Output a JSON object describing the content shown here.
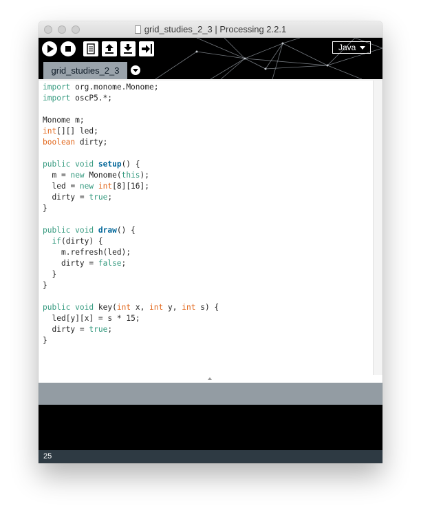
{
  "window": {
    "title": "grid_studies_2_3 | Processing 2.2.1",
    "traffic_lights": [
      "close-button",
      "minimize-button",
      "zoom-button"
    ]
  },
  "toolbar": {
    "buttons": [
      {
        "name": "run-button",
        "icon": "play-icon"
      },
      {
        "name": "stop-button",
        "icon": "stop-icon"
      },
      {
        "name": "new-button",
        "icon": "new-file-icon"
      },
      {
        "name": "open-button",
        "icon": "open-arrow-up-icon"
      },
      {
        "name": "save-button",
        "icon": "save-arrow-down-icon"
      },
      {
        "name": "export-button",
        "icon": "export-arrow-right-icon"
      }
    ],
    "mode_label": "Java"
  },
  "tabs": [
    {
      "label": "grid_studies_2_3",
      "active": true
    }
  ],
  "editor": {
    "lines": [
      "import org.monome.Monome;",
      "import oscP5.*;",
      "",
      "Monome m;",
      "int[][] led;",
      "boolean dirty;",
      "",
      "public void setup() {",
      "  m = new Monome(this);",
      "  led = new int[8][16];",
      "  dirty = true;",
      "}",
      "",
      "public void draw() {",
      "  if(dirty) {",
      "    m.refresh(led);",
      "    dirty = false;",
      "  }",
      "}",
      "",
      "public void key(int x, int y, int s) {",
      "  led[y][x] = s * 15;",
      "  dirty = true;",
      "}",
      ""
    ],
    "current_line": 25
  },
  "footer": {
    "line_number": "25"
  },
  "colors": {
    "keyword": "#33997e",
    "type": "#e2661a",
    "function": "#006699",
    "tab_bg": "#9aa3ab",
    "status_bg": "#939ca3",
    "footer_bg": "#2e3a43"
  }
}
